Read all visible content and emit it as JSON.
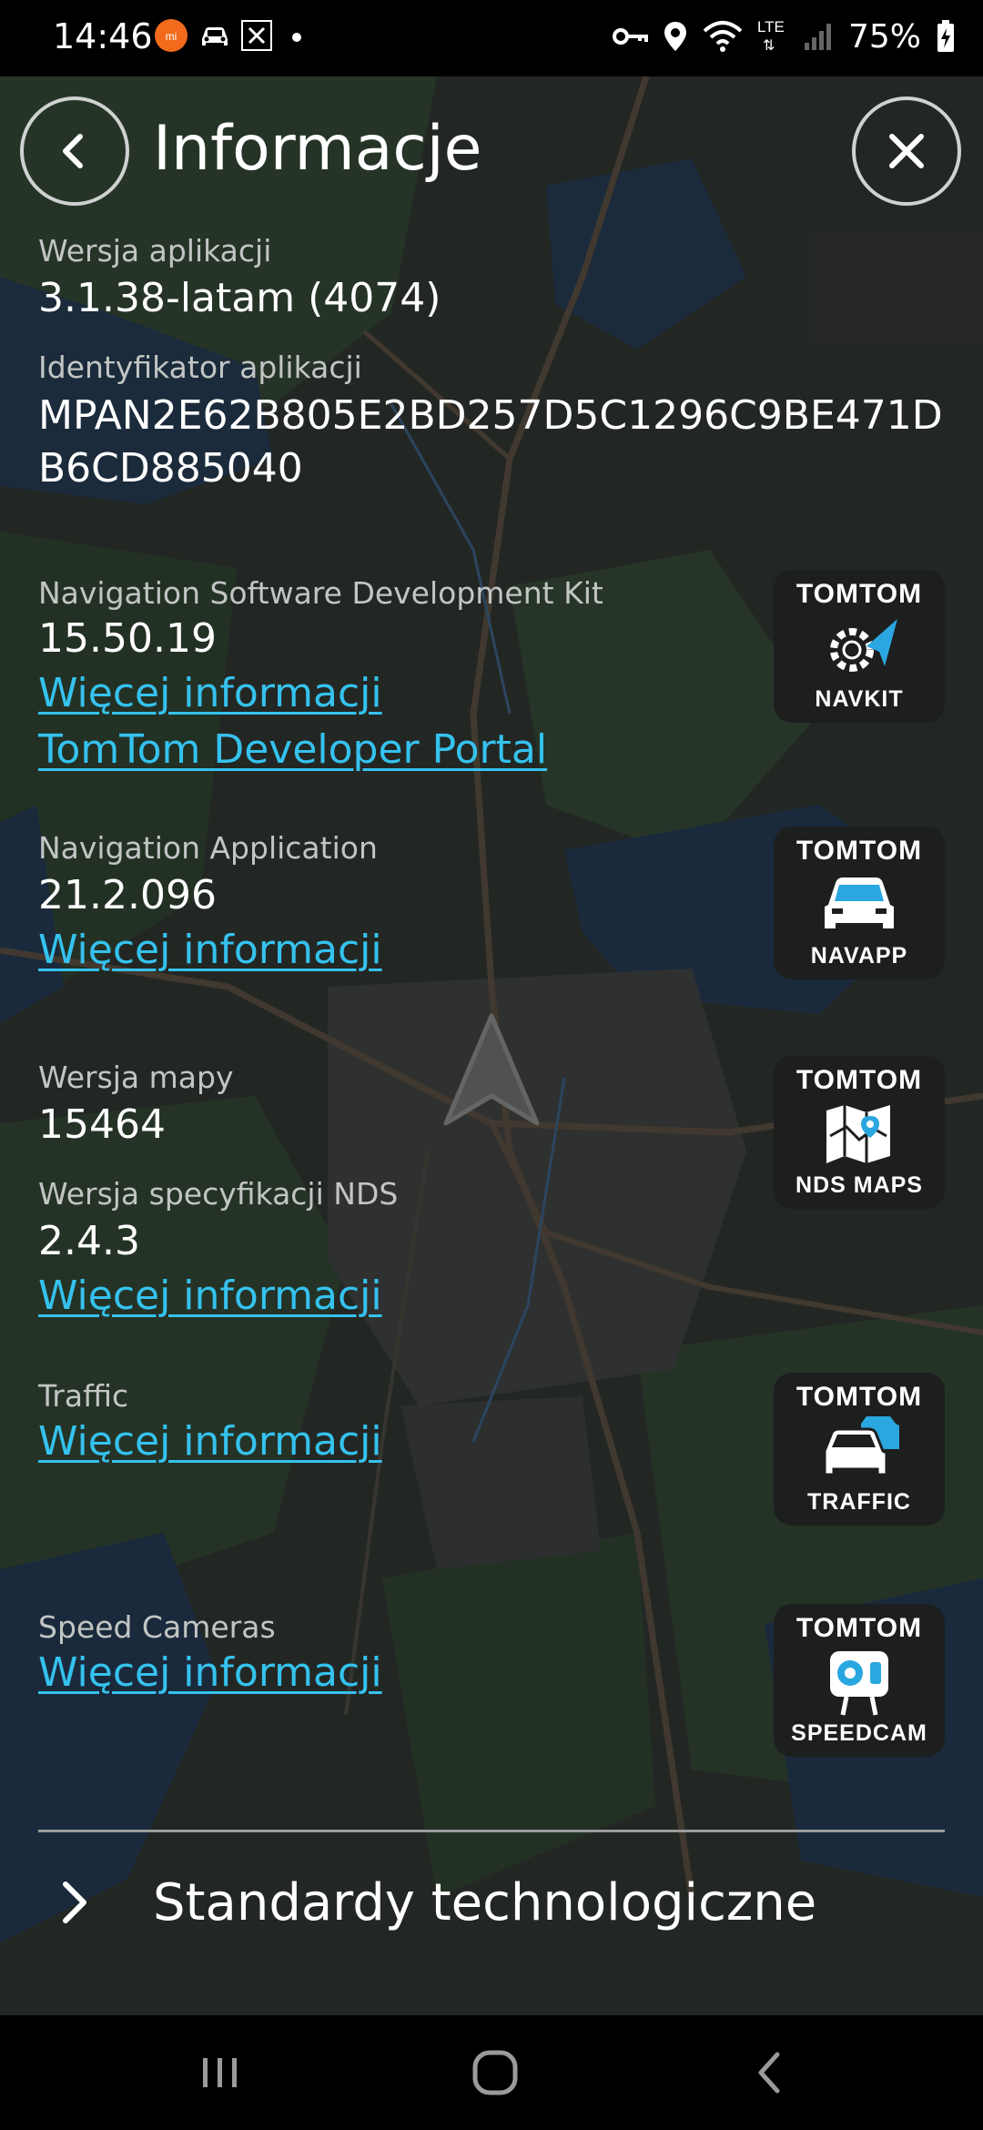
{
  "status_bar": {
    "time": "14:46",
    "left_icons": [
      "xiaomi-app-icon",
      "car-icon",
      "sync-icon",
      "dot-icon"
    ],
    "right_icons": [
      "vpn-key-icon",
      "location-icon",
      "wifi-icon",
      "lte-signal-icon",
      "cell-signal-icon"
    ],
    "lte_label": "LTE",
    "battery": "75%"
  },
  "header": {
    "title": "Informacje",
    "back_icon": "chevron-left-icon",
    "close_icon": "close-icon"
  },
  "app_info": {
    "version_label": "Wersja aplikacji",
    "version_value": "3.1.38-latam (4074)",
    "id_label": "Identyfikator aplikacji",
    "id_value": "MPAN2E62B805E2BD257D5C1296C9BE471DB6CD885040"
  },
  "sections": {
    "navkit": {
      "label": "Navigation Software Development Kit",
      "value": "15.50.19",
      "link1": "Więcej informacji",
      "link2": "TomTom Developer Portal",
      "badge_brand": "TOMTOM",
      "badge_name": "NAVKIT"
    },
    "navapp": {
      "label": "Navigation Application",
      "value": "21.2.096",
      "link1": "Więcej informacji",
      "badge_brand": "TOMTOM",
      "badge_name": "NAVAPP"
    },
    "maps": {
      "map_label": "Wersja mapy",
      "map_value": "15464",
      "nds_label": "Wersja specyfikacji NDS",
      "nds_value": "2.4.3",
      "link1": "Więcej informacji",
      "badge_brand": "TOMTOM",
      "badge_name": "NDS MAPS"
    },
    "traffic": {
      "label": "Traffic",
      "link1": "Więcej informacji",
      "badge_brand": "TOMTOM",
      "badge_name": "TRAFFIC"
    },
    "speedcam": {
      "label": "Speed Cameras",
      "link1": "Więcej informacji",
      "badge_brand": "TOMTOM",
      "badge_name": "SPEEDCAM"
    }
  },
  "standards": {
    "label": "Standardy technologiczne",
    "icon": "chevron-right-icon"
  },
  "nav_bar": {
    "recents_icon": "recents-icon",
    "home_icon": "home-icon",
    "back_icon": "back-icon"
  },
  "colors": {
    "link": "#35c2ee",
    "map_water": "#1f3a55",
    "map_green": "#2f4a33",
    "badge_bg": "#1d1e1e",
    "navkit_arrow": "#2aa7e0"
  }
}
